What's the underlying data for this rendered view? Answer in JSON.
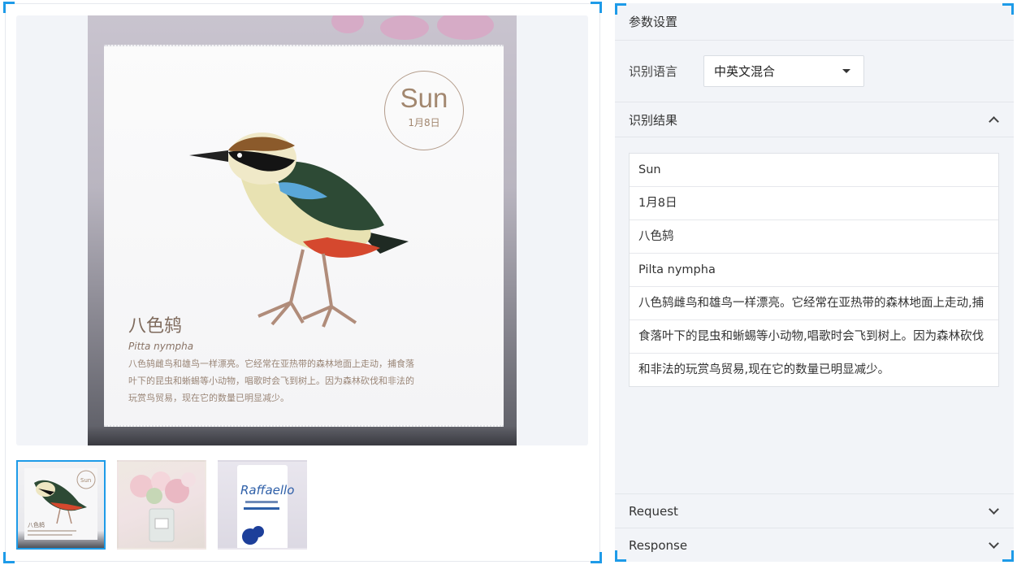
{
  "colors": {
    "accent": "#1e9be8",
    "panel_bg": "#f2f4f8"
  },
  "preview": {
    "card": {
      "day": "Sun",
      "date": "1月8日",
      "title": "八色鸫",
      "latin": "Pitta nympha",
      "desc": "八色鸫雌鸟和雄鸟一样漂亮。它经常在亚热带的森林地面上走动，捕食落叶下的昆虫和蜥蜴等小动物，唱歌时会飞到树上。因为森林砍伐和非法的玩赏鸟贸易，现在它的数量已明显减少。"
    },
    "thumbnails": [
      {
        "name": "bird-calendar",
        "active": true,
        "icon": "bird-icon",
        "mini_day": "Sun",
        "mini_title": "八色鸫"
      },
      {
        "name": "flowers",
        "active": false,
        "icon": "flower-icon"
      },
      {
        "name": "raffaello",
        "active": false,
        "icon": "box-icon",
        "brand": "Raffaello"
      }
    ]
  },
  "settings": {
    "header": "参数设置",
    "language_label": "识别语言",
    "language_value": "中英文混合",
    "results_header": "识别结果",
    "results": [
      "Sun",
      "1月8日",
      "八色鸫",
      "Pilta nympha",
      "八色鸫雌鸟和雄鸟一样漂亮。它经常在亚热带的森林地面上走动,捕",
      "食落叶下的昆虫和蜥蜴等小动物,唱歌时会飞到树上。因为森林砍伐",
      "和非法的玩赏鸟贸易,现在它的数量已明显减少。"
    ],
    "request_label": "Request",
    "response_label": "Response"
  }
}
